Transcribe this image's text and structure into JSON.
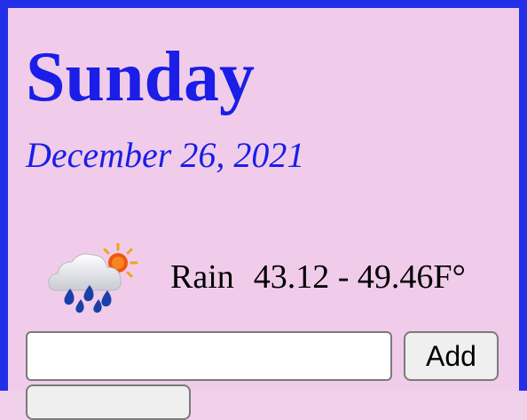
{
  "day": {
    "name": "Sunday",
    "date": "December 26, 2021"
  },
  "weather": {
    "icon": "rain-sun-cloud-icon",
    "condition": "Rain",
    "temperature": "43.12 - 49.46F°"
  },
  "task_entry": {
    "value": "",
    "placeholder": "",
    "add_label": "Add"
  },
  "colors": {
    "background": "#f0ccea",
    "border": "#2330e8",
    "heading": "#1a1ee6"
  }
}
